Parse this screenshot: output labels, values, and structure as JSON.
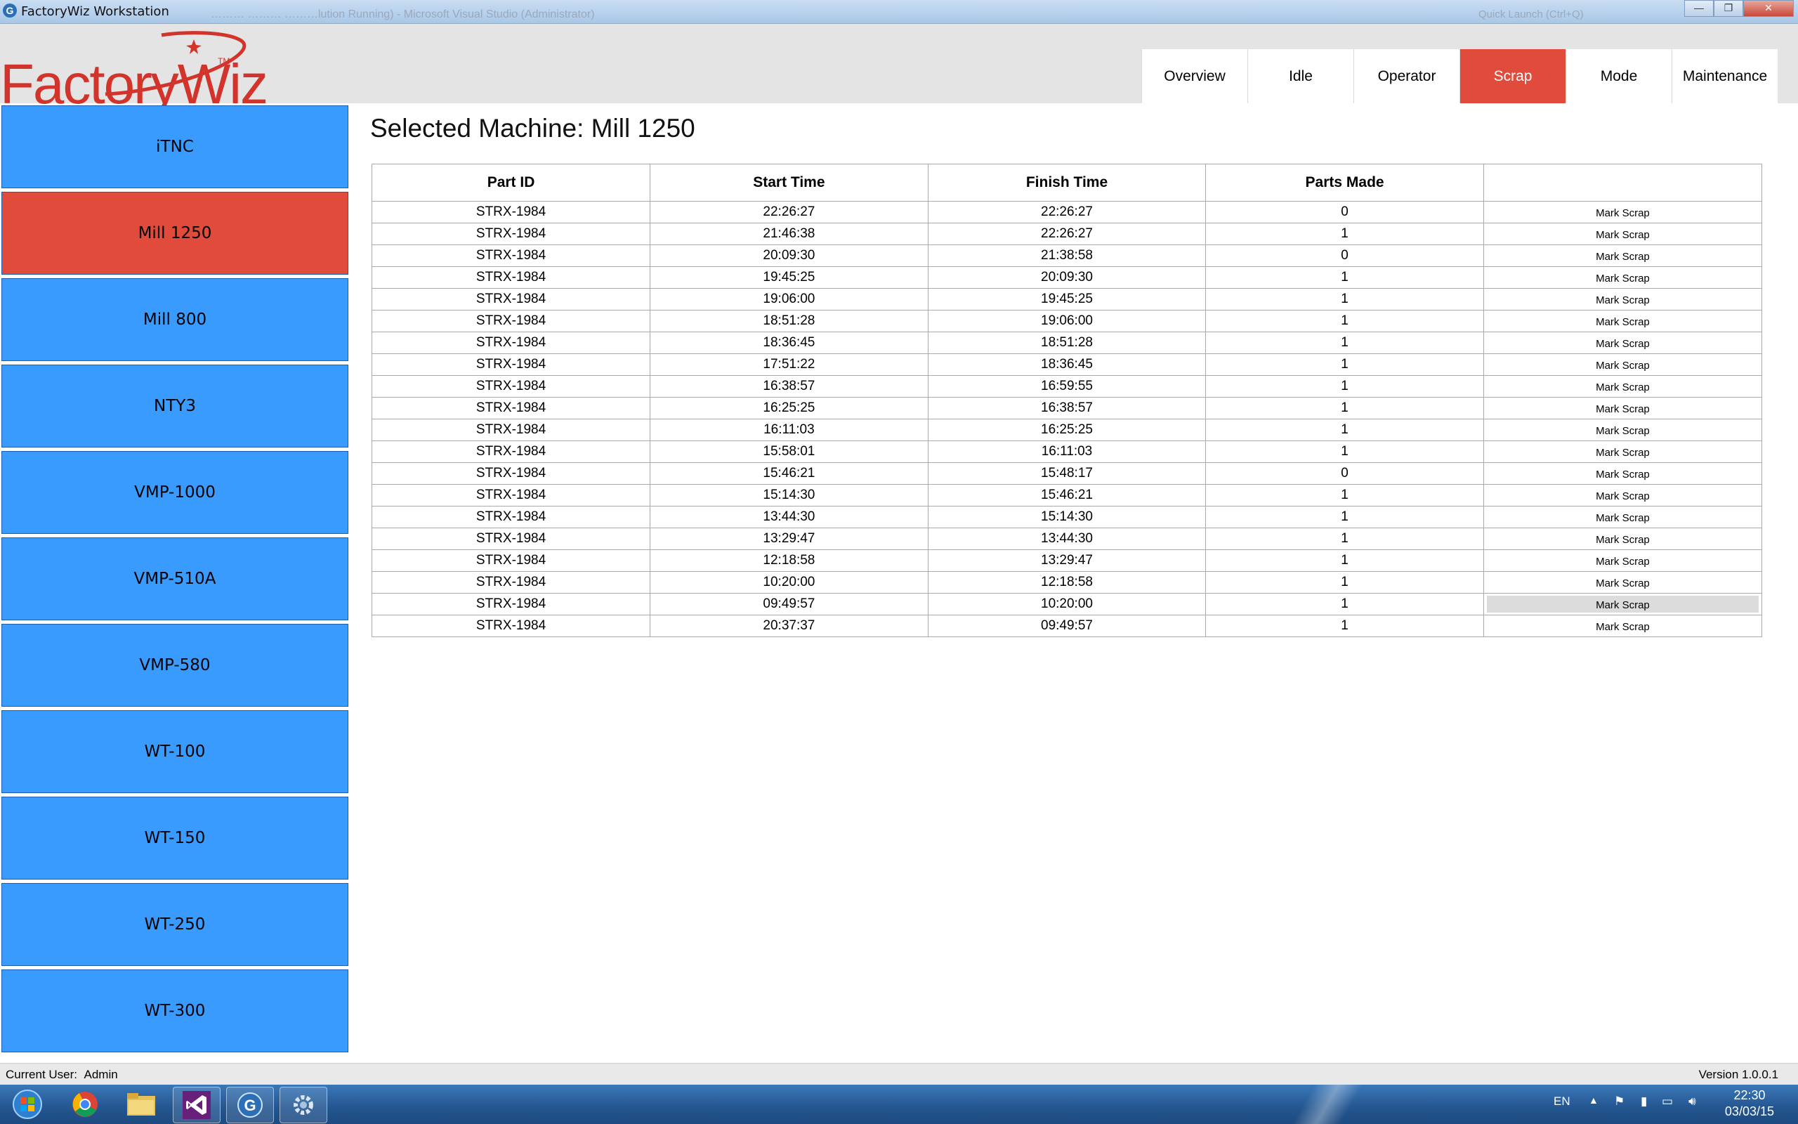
{
  "window": {
    "title": "FactoryWiz Workstation",
    "ghost_title": "……… ……… ………lution Running) - Microsoft Visual Studio (Administrator)",
    "ghost_search": "Quick Launch (Ctrl+Q)",
    "app_icon_letter": "G",
    "minimize_glyph": "—",
    "maximize_glyph": "❐",
    "close_glyph": "✕"
  },
  "brand": {
    "logo": "FactoryWiz",
    "trademark": "TM",
    "color": "#d2342b"
  },
  "nav_tabs": [
    {
      "label": "Overview",
      "active": false
    },
    {
      "label": "Idle",
      "active": false
    },
    {
      "label": "Operator",
      "active": false
    },
    {
      "label": "Scrap",
      "active": true
    },
    {
      "label": "Mode",
      "active": false
    },
    {
      "label": "Maintenance",
      "active": false
    }
  ],
  "machines": [
    {
      "label": "iTNC",
      "selected": false
    },
    {
      "label": "Mill 1250",
      "selected": true
    },
    {
      "label": "Mill 800",
      "selected": false
    },
    {
      "label": "NTY3",
      "selected": false
    },
    {
      "label": "VMP-1000",
      "selected": false
    },
    {
      "label": "VMP-510A",
      "selected": false
    },
    {
      "label": "VMP-580",
      "selected": false
    },
    {
      "label": "WT-100",
      "selected": false
    },
    {
      "label": "WT-150",
      "selected": false
    },
    {
      "label": "WT-250",
      "selected": false
    },
    {
      "label": "WT-300",
      "selected": false
    }
  ],
  "main": {
    "title": "Selected Machine: Mill 1250",
    "columns": [
      "Part ID",
      "Start Time",
      "Finish Time",
      "Parts Made",
      ""
    ],
    "action_label": "Mark Scrap",
    "rows": [
      [
        "STRX-1984",
        "22:26:27",
        "22:26:27",
        "0"
      ],
      [
        "STRX-1984",
        "21:46:38",
        "22:26:27",
        "1"
      ],
      [
        "STRX-1984",
        "20:09:30",
        "21:38:58",
        "0"
      ],
      [
        "STRX-1984",
        "19:45:25",
        "20:09:30",
        "1"
      ],
      [
        "STRX-1984",
        "19:06:00",
        "19:45:25",
        "1"
      ],
      [
        "STRX-1984",
        "18:51:28",
        "19:06:00",
        "1"
      ],
      [
        "STRX-1984",
        "18:36:45",
        "18:51:28",
        "1"
      ],
      [
        "STRX-1984",
        "17:51:22",
        "18:36:45",
        "1"
      ],
      [
        "STRX-1984",
        "16:38:57",
        "16:59:55",
        "1"
      ],
      [
        "STRX-1984",
        "16:25:25",
        "16:38:57",
        "1"
      ],
      [
        "STRX-1984",
        "16:11:03",
        "16:25:25",
        "1"
      ],
      [
        "STRX-1984",
        "15:58:01",
        "16:11:03",
        "1"
      ],
      [
        "STRX-1984",
        "15:46:21",
        "15:48:17",
        "0"
      ],
      [
        "STRX-1984",
        "15:14:30",
        "15:46:21",
        "1"
      ],
      [
        "STRX-1984",
        "13:44:30",
        "15:14:30",
        "1"
      ],
      [
        "STRX-1984",
        "13:29:47",
        "13:44:30",
        "1"
      ],
      [
        "STRX-1984",
        "12:18:58",
        "13:29:47",
        "1"
      ],
      [
        "STRX-1984",
        "10:20:00",
        "12:18:58",
        "1"
      ],
      [
        "STRX-1984",
        "09:49:57",
        "10:20:00",
        "1"
      ],
      [
        "STRX-1984",
        "20:37:37",
        "09:49:57",
        "1"
      ]
    ],
    "hover_row_index": 18
  },
  "status": {
    "current_user_label": "Current User:",
    "current_user": "Admin",
    "version": "Version 1.0.0.1"
  },
  "taskbar": {
    "items": [
      "windows-start-icon",
      "chrome-icon",
      "file-explorer-icon",
      "visual-studio-icon",
      "factorywiz-icon",
      "settings-gear-icon"
    ],
    "language": "EN",
    "time": "22:30",
    "date": "03/03/15"
  },
  "colors": {
    "machine_blue": "#3a9bff",
    "selected_red": "#e04b3b"
  }
}
